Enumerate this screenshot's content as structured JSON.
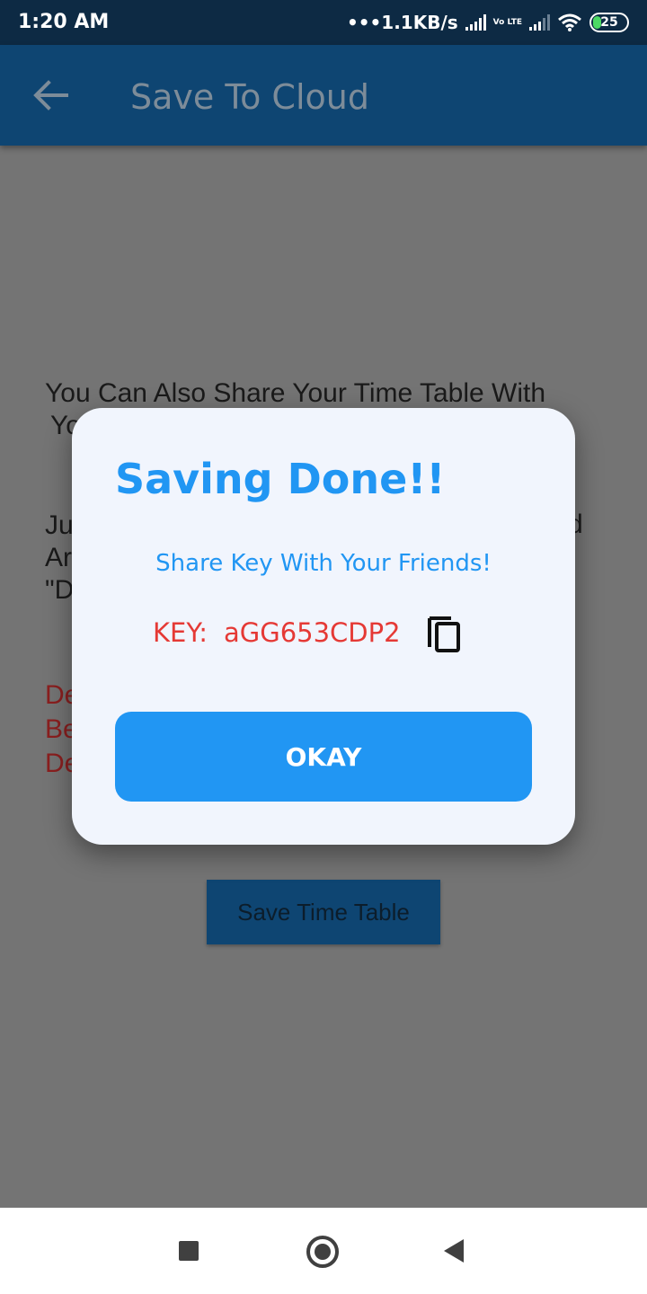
{
  "status_bar": {
    "time": "1:20 AM",
    "net_speed": "•••1.1KB/s",
    "lte_label": "Vo LTE",
    "battery": "25"
  },
  "app_bar": {
    "title": "Save To Cloud",
    "back_icon": "arrow-left-icon"
  },
  "background_content": {
    "info_line1": "You Can Also Share Your Time Table With",
    "info_line2": "Yo",
    "para2_visible": [
      "Ju",
      "Ar",
      "\"D"
    ],
    "para2_right_fragment": "d",
    "para3_visible": [
      "De",
      "Be",
      "De"
    ],
    "save_button_label": "Save Time Table"
  },
  "dialog": {
    "title": "Saving Done!!",
    "message": "Share Key With Your Friends!",
    "key_label": "KEY:",
    "key_value": "aGG653CDP2",
    "copy_icon": "copy-icon",
    "okay_label": "OKAY"
  },
  "colors": {
    "app_bar": "#0e4572",
    "status_bar": "#0d2a44",
    "dialog_accent": "#2196f3",
    "key_color": "#e53935",
    "dialog_bg": "#f1f5fd"
  }
}
